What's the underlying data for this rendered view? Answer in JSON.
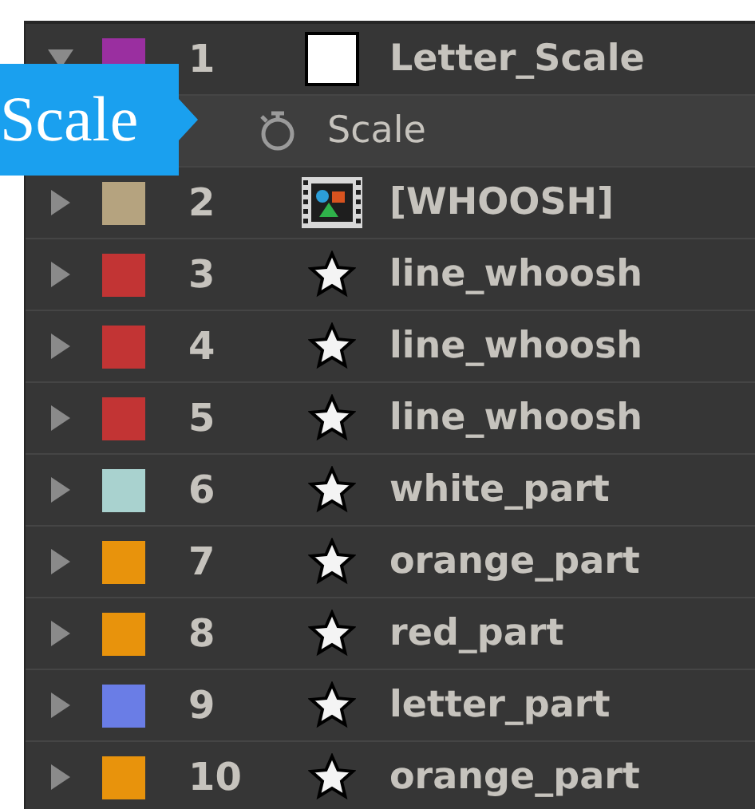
{
  "callout": {
    "text": "Scale"
  },
  "layers": [
    {
      "number": "1",
      "name": "Letter_Scale",
      "kind": "solid",
      "color": "#9a2fa0",
      "expanded": true,
      "properties": [
        {
          "name": "Scale"
        }
      ]
    },
    {
      "number": "2",
      "name": "[WHOOSH]",
      "kind": "footage",
      "color": "#b5a37f",
      "expanded": false
    },
    {
      "number": "3",
      "name": "line_whoosh",
      "kind": "shape",
      "color": "#c23434",
      "expanded": false
    },
    {
      "number": "4",
      "name": "line_whoosh",
      "kind": "shape",
      "color": "#c23434",
      "expanded": false
    },
    {
      "number": "5",
      "name": "line_whoosh",
      "kind": "shape",
      "color": "#c23434",
      "expanded": false
    },
    {
      "number": "6",
      "name": "white_part",
      "kind": "shape",
      "color": "#a9d2cf",
      "expanded": false
    },
    {
      "number": "7",
      "name": "orange_part",
      "kind": "shape",
      "color": "#e8930c",
      "expanded": false
    },
    {
      "number": "8",
      "name": "red_part",
      "kind": "shape",
      "color": "#e8930c",
      "expanded": false
    },
    {
      "number": "9",
      "name": "letter_part",
      "kind": "shape",
      "color": "#6a7de6",
      "expanded": false
    },
    {
      "number": "10",
      "name": "orange_part",
      "kind": "shape",
      "color": "#e8930c",
      "expanded": false
    }
  ]
}
